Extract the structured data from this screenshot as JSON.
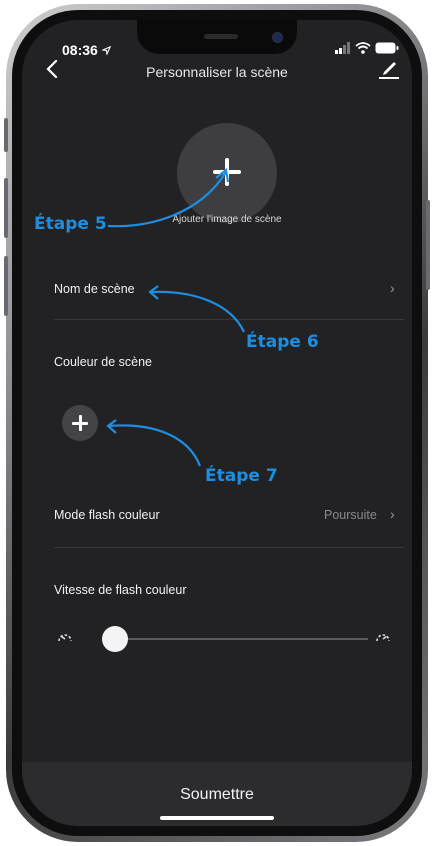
{
  "status_bar": {
    "time": "08:36",
    "location_icon": "location-arrow-icon",
    "icons": [
      "signal-icon",
      "wifi-icon",
      "battery-icon"
    ]
  },
  "header": {
    "title": "Personnaliser la scène",
    "back_icon": "chevron-left-icon",
    "edit_icon": "pencil-icon"
  },
  "scene_image": {
    "label": "Ajouter l'image de scène"
  },
  "scene_name": {
    "label": "Nom de scène"
  },
  "scene_color": {
    "label": "Couleur de scène"
  },
  "flash_mode": {
    "label": "Mode flash couleur",
    "value": "Poursuite"
  },
  "flash_speed": {
    "label": "Vitesse de flash couleur",
    "value": 0
  },
  "footer": {
    "submit_label": "Soumettre"
  },
  "annotations": {
    "step5": "Étape 5",
    "step6": "Étape 6",
    "step7": "Étape 7"
  },
  "colors": {
    "accent": "#1d8fe1",
    "background": "#222224",
    "text": "#ffffff"
  }
}
